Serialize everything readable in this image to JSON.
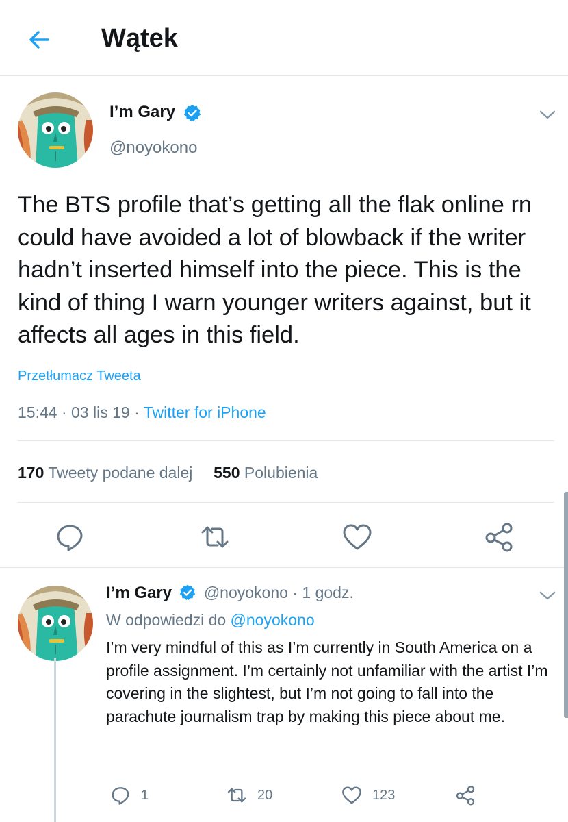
{
  "header": {
    "title": "Wątek"
  },
  "tweet": {
    "author_name": "I’m Gary",
    "author_handle": "@noyokono",
    "text": "The BTS profile that’s getting all the flak online rn could have avoided a lot of blowback if the writer hadn’t inserted himself into the piece. This is the kind of thing I warn younger writers against, but it affects all ages in this field.",
    "translate_label": "Przetłumacz Tweeta",
    "time": "15:44",
    "date": "03 lis 19",
    "source": "Twitter for iPhone",
    "retweet_count": "170",
    "retweet_label": "Tweety podane dalej",
    "like_count": "550",
    "like_label": "Polubienia"
  },
  "reply": {
    "author_name": "I’m Gary",
    "author_handle": "@noyokono",
    "time_ago": "1 godz.",
    "replying_prefix": "W odpowiedzi do",
    "replying_to": "@noyokono",
    "text": "I’m very mindful of this as I’m currently in South America on a profile assignment. I’m certainly not unfamiliar with the artist I’m covering in the slightest, but I’m not going to fall into the parachute journalism trap by making this piece about me.",
    "reply_count": "1",
    "retweet_count": "20",
    "like_count": "123"
  },
  "colors": {
    "accent": "#1da1f2",
    "muted": "#657786",
    "text": "#14171a",
    "divider": "#e1e8ed"
  },
  "icons": [
    "back-arrow-icon",
    "verified-badge-icon",
    "chevron-down-icon",
    "reply-icon",
    "retweet-icon",
    "like-icon",
    "share-icon"
  ]
}
